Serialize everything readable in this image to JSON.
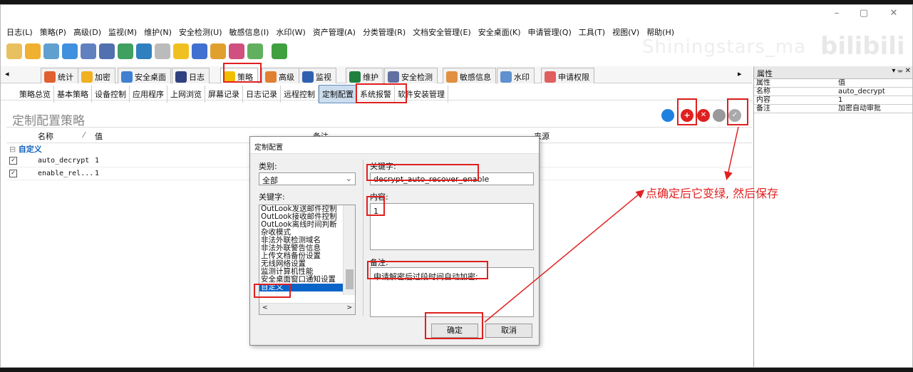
{
  "menu": [
    "日志(L)",
    "策略(P)",
    "高级(D)",
    "监视(M)",
    "维护(N)",
    "安全检测(U)",
    "敏感信息(I)",
    "水印(W)",
    "资产管理(A)",
    "分类管理(R)",
    "文档安全管理(E)",
    "安全桌面(K)",
    "申请管理(Q)",
    "工具(T)",
    "视图(V)",
    "帮助(H)"
  ],
  "watermark": "Shiningstars_ma",
  "brand": "bilibili",
  "window_buttons": {
    "min": "–",
    "max": "▢",
    "close": "✕"
  },
  "tabs": [
    "统计",
    "加密",
    "安全桌面",
    "日志",
    "策略",
    "高级",
    "监视",
    "维护",
    "安全检测",
    "敏感信息",
    "水印",
    "申请权限"
  ],
  "subtabs": [
    "策略总览",
    "基本策略",
    "设备控制",
    "应用程序",
    "上网浏览",
    "屏幕记录",
    "日志记录",
    "远程控制",
    "定制配置",
    "系统报警",
    "软件安装管理"
  ],
  "panel_title": "定制配置策略",
  "grid": {
    "headers": [
      "名称",
      "值",
      "备注",
      "来源"
    ],
    "group": "自定义",
    "rows": [
      {
        "name": "auto_decrypt",
        "value": "1"
      },
      {
        "name": "enable_rel...",
        "value": "1"
      }
    ]
  },
  "props": {
    "title": "属性",
    "col1": "属性",
    "col2": "值",
    "rows": [
      [
        "名称",
        "auto_decrypt"
      ],
      [
        "内容",
        "1"
      ],
      [
        "备注",
        "加密自动审批"
      ]
    ]
  },
  "dialog": {
    "title": "定制配置",
    "category_label": "类别:",
    "category_value": "全部",
    "keyword_label": "关键字:",
    "keyword_value": "decrypt_auto_recover_enable",
    "list_label": "关键字:",
    "list": [
      "OutLook发送邮件控制",
      "OutLook接收邮件控制",
      "OutLook离线时间判断",
      "杂收模式",
      "非法外联检测域名",
      "非法外联警告信息",
      "上传文档备份设置",
      "无线网络设置",
      "监测计算机性能",
      "安全桌面窗口通知设置",
      "自定义"
    ],
    "content_label": "内容:",
    "content_value": "1",
    "remark_label": "备注:",
    "remark_value": "申请解密后过段时间自动加密;",
    "ok": "确定",
    "cancel": "取消"
  },
  "annotation": "点确定后它变绿, 然后保存"
}
